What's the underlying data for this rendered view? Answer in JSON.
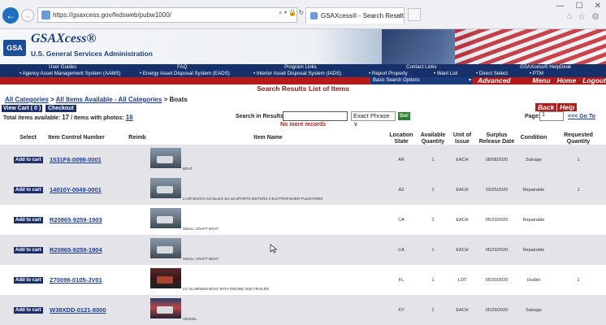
{
  "browser": {
    "url": "https://gsaxcess.gov/fedsweb/pubw1000/",
    "address_tools": "⌕ ▾ 🔒 ↻",
    "tab_title": "GSAXcess® - Search Result...",
    "tab_close": "×",
    "window_controls": [
      "—",
      "☐",
      "✕"
    ],
    "right_icons": [
      "⌂",
      "☆",
      "⚙"
    ],
    "back_icon": "←",
    "forward_icon": "→"
  },
  "header": {
    "logo": "GSA",
    "site_title": "GSAXcess®",
    "agency": "U.S. General Services Administration"
  },
  "nav": {
    "top": [
      "User Guides",
      "FAQ",
      "Program Links",
      "Contact Links",
      "GSAXcess® HelpDesk"
    ],
    "bottom": [
      "• Agency Asset Management System (AAMS)",
      "• Energy Asset Disposal System (EADS)",
      "• Interior Asset Disposal System (IADS)",
      "• Report Property",
      "• Want List",
      "• Direct Select",
      "• PTM"
    ],
    "search_options": "Basic Search Options",
    "search_options_arrow": "▾",
    "advanced": [
      "Advanced Search",
      "Menu",
      "Home",
      "Logout"
    ]
  },
  "page": {
    "heading": "Search Results List of Items",
    "breadcrumb": {
      "all_categories": "All Categories",
      "sep1": " > ",
      "all_items": "All Items Available - All Categories",
      "sep2": " > ",
      "current": "Boats"
    },
    "view_cart": "View Cart ( 0 )",
    "checkout": "Checkout",
    "totals_prefix": "Total items available: ",
    "totals_count": "17",
    "totals_mid": " / Items with photos: ",
    "photos_count": "16",
    "search_label": "Search in Results:",
    "search_value": "",
    "phrase_option": "Exact Phrase ∨",
    "go": "Go!",
    "back": "Back",
    "help": "Help",
    "page_label": "Page:",
    "page_value": "1",
    "goto": "<<< Go To",
    "no_more": "No more records"
  },
  "table": {
    "headers": {
      "select": "Select",
      "icn": "Item Control Number",
      "reimb": "Reimb",
      "item_name": "Item Name",
      "location": "Location State",
      "available": "Available Quantity",
      "unit": "Unit of Issue",
      "surplus": "Surplus Release Date",
      "condition": "Condition",
      "requested": "Requested Quantity"
    },
    "add_label": "Add to cart",
    "rows": [
      {
        "icn": "1531F8-0098-0001",
        "name": "BOAT",
        "state": "AR",
        "qty": "1",
        "unit": "EACH",
        "date": "08/08/2020",
        "cond": "Salvage",
        "req": "1"
      },
      {
        "icn": "14010Y-0049-0001",
        "name": "2 AIR BOATS ACHILLES SU-16 SPORTS MOTORS 3 ELCTROFISHER PULSATORS",
        "state": "AZ",
        "qty": "1",
        "unit": "EACH",
        "date": "03/25/2020",
        "cond": "Repairable",
        "req": "1"
      },
      {
        "icn": "R20865-9259-1903",
        "name": "SMALL CRAFT BOAT",
        "state": "CA",
        "qty": "1",
        "unit": "EACH",
        "date": "05/23/2020",
        "cond": "Repairable",
        "req": ""
      },
      {
        "icn": "R20865-9259-1904",
        "name": "SMALL CRAFT BOAT",
        "state": "CA",
        "qty": "1",
        "unit": "EACH",
        "date": "05/23/2020",
        "cond": "Repairable",
        "req": ""
      },
      {
        "icn": "Z70098-0105-JV01",
        "name": "24' ALUMINUM BOAT WITH ENGINE AND TRAILER",
        "state": "FL",
        "qty": "1",
        "unit": "LOT",
        "date": "05/20/2020",
        "cond": "Usable",
        "req": "1"
      },
      {
        "icn": "W38XDD-0121-8000",
        "name": "VESSEL",
        "state": "KY",
        "qty": "1",
        "unit": "EACH",
        "date": "05/29/2020",
        "cond": "Salvage",
        "req": ""
      }
    ]
  }
}
